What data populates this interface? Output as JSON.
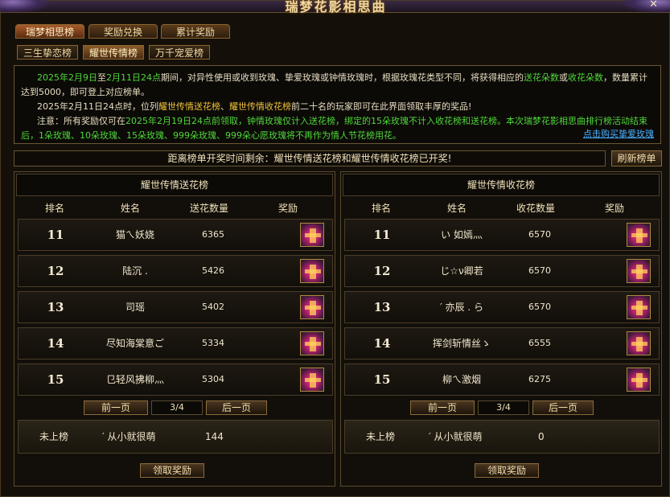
{
  "window": {
    "title": "瑞梦花影相思曲"
  },
  "tabs_main": [
    {
      "label": "瑞梦相思榜",
      "active": true
    },
    {
      "label": "奖励兑换",
      "active": false
    },
    {
      "label": "累计奖励",
      "active": false
    }
  ],
  "tabs_sub": [
    {
      "label": "三生挚恋榜",
      "active": false
    },
    {
      "label": "耀世传情榜",
      "active": true
    },
    {
      "label": "万千宠爱榜",
      "active": false
    }
  ],
  "notice": {
    "p1_a": "2025年2月9日",
    "p1_b": "至",
    "p1_c": "2月11日24点",
    "p1_d": "期间，对异性使用或收到玫瑰、挚爱玫瑰或钟情玫瑰时，根据玫瑰花类型不同，将获得相应的",
    "p1_e": "送花朵数",
    "p1_f": "或",
    "p1_g": "收花朵数",
    "p1_h": "，数量累计达到5000，即可登上对应榜单。",
    "p2_a": "2025年2月11日24点",
    "p2_b": "时，位列",
    "p2_c": "耀世传情送花榜",
    "p2_d": "、",
    "p2_e": "耀世传情收花榜",
    "p2_f": "前二十名",
    "p2_g": "的玩家即可在此界面领取丰厚的奖品!",
    "p3_a": "注意：所有奖励仅可在",
    "p3_b": "2025年2月19日24点",
    "p3_c": "前领取，钟情玫瑰仅计入送花榜，绑定的15朵玫瑰不计入收花榜和送花榜。本次瑞梦花影相思曲排行榜活动结束后，1朵玫瑰、10朵玫瑰、15朵玫瑰、999朵玫瑰、999朵心愿玫瑰将不再作为情人节花榜用花。",
    "buy_link": "点击购买挚爱玫瑰"
  },
  "countdown": "距离榜单开奖时间剩余：耀世传情送花榜和耀世传情收花榜已开奖!",
  "refresh_label": "刷新榜单",
  "send_board": {
    "title": "耀世传情送花榜",
    "columns": [
      "排名",
      "姓名",
      "送花数量",
      "奖励"
    ],
    "rows": [
      {
        "rank": "11",
        "name": "猫ㄟ妖娆",
        "count": "6365"
      },
      {
        "rank": "12",
        "name": "陆沉 .",
        "count": "5426"
      },
      {
        "rank": "13",
        "name": "司瑶",
        "count": "5402"
      },
      {
        "rank": "14",
        "name": "尽知海棠意ご",
        "count": "5334"
      },
      {
        "rank": "15",
        "name": "⺋轻风拂柳灬",
        "count": "5304"
      }
    ],
    "prev": "前一页",
    "page": "3/4",
    "next": "后一页",
    "mine": {
      "rank": "未上榜",
      "name": "′ 从小就很萌",
      "count": "144"
    },
    "claim": "领取奖励"
  },
  "recv_board": {
    "title": "耀世传情收花榜",
    "columns": [
      "排名",
      "姓名",
      "收花数量",
      "奖励"
    ],
    "rows": [
      {
        "rank": "11",
        "name": "い 如嫣灬",
        "count": "6570"
      },
      {
        "rank": "12",
        "name": "じ☆ν卿若",
        "count": "6570"
      },
      {
        "rank": "13",
        "name": "′ 亦辰 . ら",
        "count": "6570"
      },
      {
        "rank": "14",
        "name": "挥剑斩情丝ゝ",
        "count": "6555"
      },
      {
        "rank": "15",
        "name": "柳ㄟ激烟",
        "count": "6275"
      }
    ],
    "prev": "前一页",
    "page": "3/4",
    "next": "后一页",
    "mine": {
      "rank": "未上榜",
      "name": "′ 从小就很萌",
      "count": "0"
    },
    "claim": "领取奖励"
  },
  "icons": {
    "reward": "gift-box-icon",
    "close": "close-icon"
  }
}
